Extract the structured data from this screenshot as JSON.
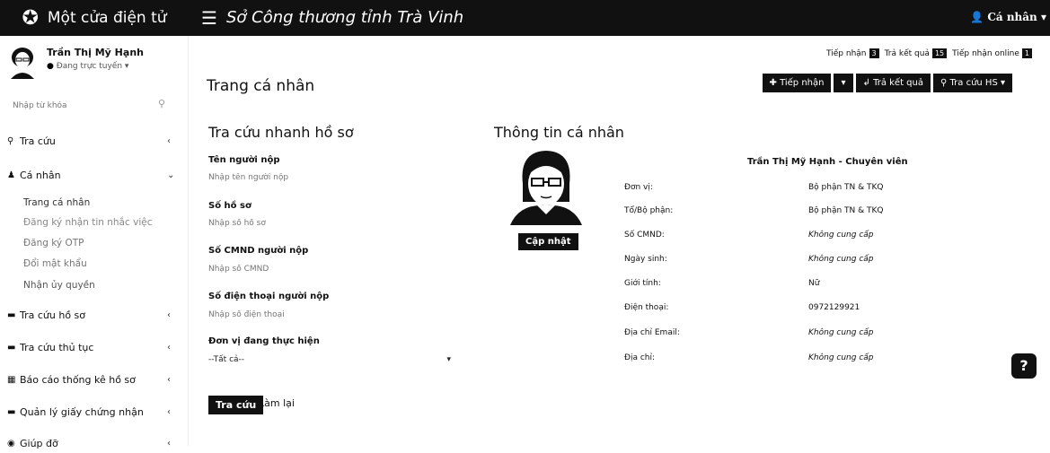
{
  "topbar": {
    "brand": "Một cửa điện tử",
    "system_title": "Sở Công thương tỉnh Trà Vinh",
    "user_menu": "Cá nhân"
  },
  "sidebar": {
    "user_name": "Trần Thị Mỹ Hạnh",
    "user_status": "Đang trực tuyến",
    "search_placeholder": "Nhập từ khóa",
    "items": [
      {
        "label": "Tra cứu",
        "icon": "search-icon"
      },
      {
        "label": "Cá nhân",
        "icon": "user-icon"
      },
      {
        "label": "Tra cứu hồ sơ",
        "icon": "folder-icon"
      },
      {
        "label": "Tra cứu thủ tục",
        "icon": "list-icon"
      },
      {
        "label": "Báo cáo thống kê hồ sơ",
        "icon": "chart-icon"
      },
      {
        "label": "Quản lý giấy chứng nhận",
        "icon": "certificate-icon"
      },
      {
        "label": "Giúp đỡ",
        "icon": "help-icon"
      }
    ],
    "subitems": [
      "Trang cá nhân",
      "Đăng ký nhận tin nhắc việc",
      "Đăng ký OTP",
      "Đổi mật khẩu",
      "Nhận ủy quyền"
    ]
  },
  "header": {
    "counts": [
      {
        "label": "Tiếp nhận",
        "value": "3"
      },
      {
        "label": "Trả kết quả",
        "value": "15"
      },
      {
        "label": "Tiếp nhận online",
        "value": "1"
      }
    ],
    "page_title": "Trang cá nhân",
    "buttons": {
      "receive": "Tiếp nhận",
      "return": "Trả kết quả",
      "lookup": "Tra cứu HS"
    }
  },
  "quick_search": {
    "title": "Tra cứu nhanh hồ sơ",
    "fields": [
      {
        "label": "Tên người nộp",
        "placeholder": "Nhập tên người nộp"
      },
      {
        "label": "Số hồ sơ",
        "placeholder": "Nhập số hồ sơ"
      },
      {
        "label": "Số CMND người nộp",
        "placeholder": "Nhập số CMND"
      },
      {
        "label": "Số điện thoại người nộp",
        "placeholder": "Nhập số điện thoại"
      }
    ],
    "unit_label": "Đơn vị đang thực hiện",
    "unit_value": "--Tất cả--",
    "search_button": "Tra cứu",
    "reset_button": "Làm lại"
  },
  "personal_info": {
    "title": "Thông tin cá nhân",
    "update_button": "Cập nhật",
    "full_name": "Trần Thị Mỹ Hạnh - Chuyên viên",
    "rows": [
      {
        "label": "Đơn vị:",
        "value": "Bộ phận TN & TKQ",
        "italic": false
      },
      {
        "label": "Tổ/Bộ phận:",
        "value": "Bộ phận TN & TKQ",
        "italic": false
      },
      {
        "label": "Số CMND:",
        "value": "Không cung cấp",
        "italic": true
      },
      {
        "label": "Ngày sinh:",
        "value": "Không cung cấp",
        "italic": true
      },
      {
        "label": "Giới tính:",
        "value": "Nữ",
        "italic": false
      },
      {
        "label": "Điện thoại:",
        "value": "0972129921",
        "italic": false
      },
      {
        "label": "Địa chỉ Email:",
        "value": "Không cung cấp",
        "italic": true
      },
      {
        "label": "Địa chỉ:",
        "value": "Không cung cấp",
        "italic": true
      }
    ]
  }
}
